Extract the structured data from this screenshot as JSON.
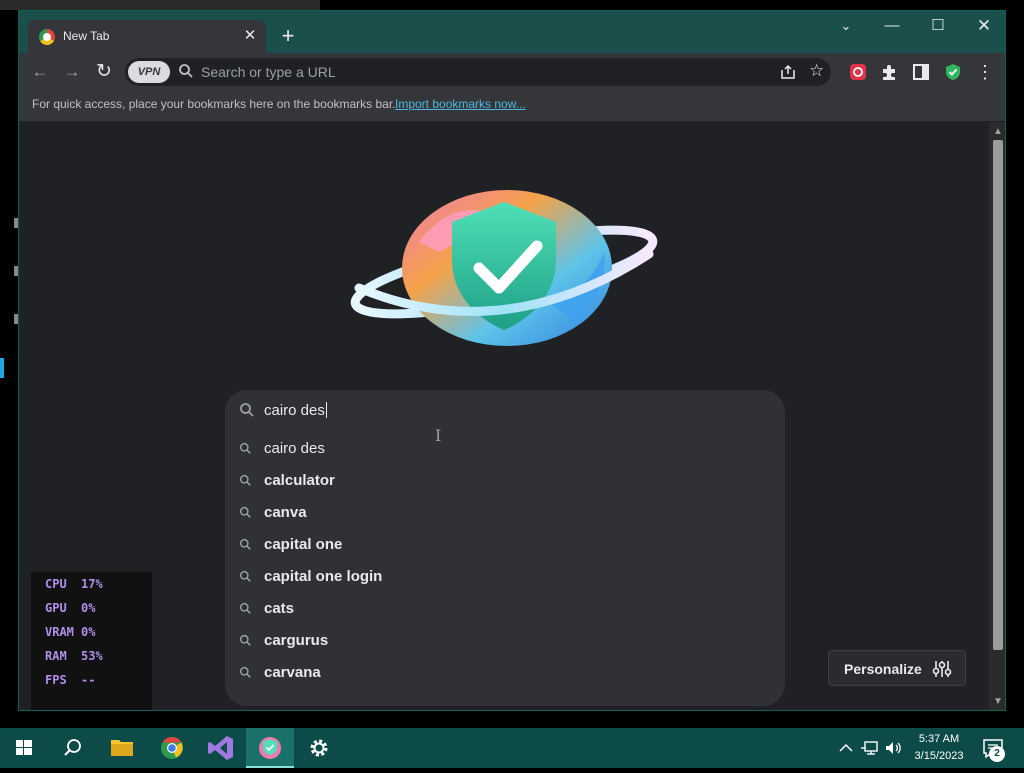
{
  "browser": {
    "tab_title": "New Tab",
    "tab_close": "✕",
    "new_tab": "+",
    "window_controls": {
      "tab_search": "⌄",
      "minimize": "—",
      "maximize": "☐",
      "close": "✕"
    }
  },
  "toolbar": {
    "vpn_label": "VPN",
    "omnibox_placeholder": "Search or type a URL",
    "menu": "⋮"
  },
  "bookmarks_bar": {
    "message": "For quick access, place your bookmarks here on the bookmarks bar.",
    "import_link": "Import bookmarks now..."
  },
  "search": {
    "query": "cairo des",
    "suggestions": [
      "cairo des",
      "calculator",
      "canva",
      "capital one",
      "capital one login",
      "cats",
      "cargurus",
      "carvana"
    ]
  },
  "personalize": {
    "label": "Personalize"
  },
  "perf_overlay": {
    "stats": [
      {
        "label": "CPU",
        "value": "17%"
      },
      {
        "label": "GPU",
        "value": "0%"
      },
      {
        "label": "VRAM",
        "value": "0%"
      },
      {
        "label": "RAM",
        "value": "53%"
      },
      {
        "label": "FPS",
        "value": "--"
      }
    ]
  },
  "taskbar": {
    "time": "5:37 AM",
    "date": "3/15/2023",
    "notification_count": "2"
  },
  "colors": {
    "titlebar": "#1a4f4c",
    "taskbar": "#0c4b47",
    "page_bg": "#202124",
    "stats_text": "#b08fe8",
    "link": "#4eb8e0"
  }
}
